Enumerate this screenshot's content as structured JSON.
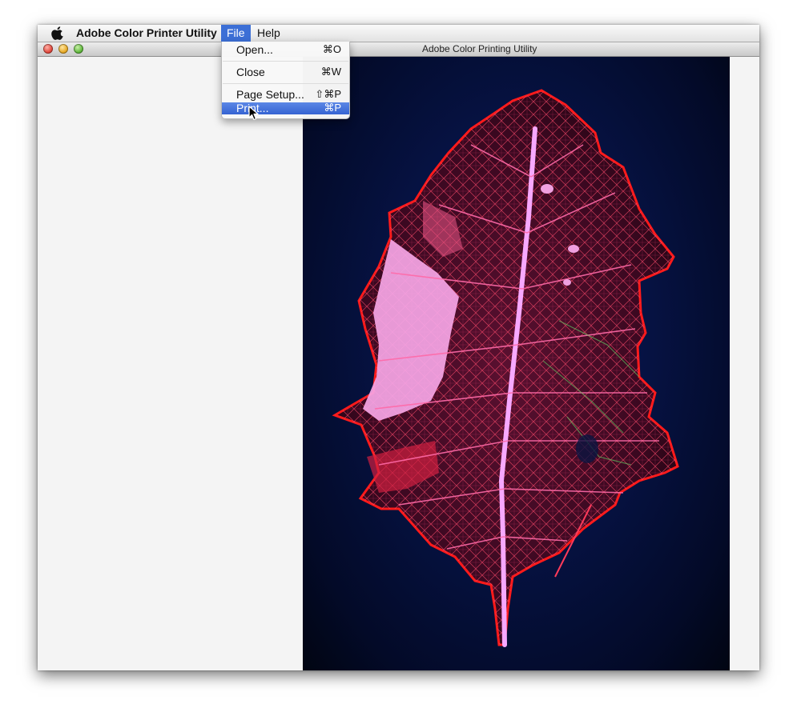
{
  "menubar": {
    "app_name": "Adobe Color Printer Utility",
    "menus": [
      "File",
      "Help"
    ]
  },
  "window": {
    "title": "Adobe Color Printing Utility"
  },
  "file_menu": {
    "items": [
      {
        "label": "Open...",
        "shortcut": "⌘O"
      },
      {
        "label": "Close",
        "shortcut": "⌘W"
      },
      {
        "label": "Page Setup...",
        "shortcut": "⇧⌘P"
      },
      {
        "label": "Print...",
        "shortcut": "⌘P"
      }
    ],
    "highlighted": "Print..."
  },
  "colors": {
    "menu_highlight": "#3c6fd6",
    "image_background": "#061242",
    "leaf_edge": "#ff2020",
    "leaf_fill": "#ff90d8"
  },
  "icons": [
    "apple-icon",
    "close-window-icon",
    "minimize-window-icon",
    "zoom-window-icon",
    "mouse-pointer-icon"
  ]
}
